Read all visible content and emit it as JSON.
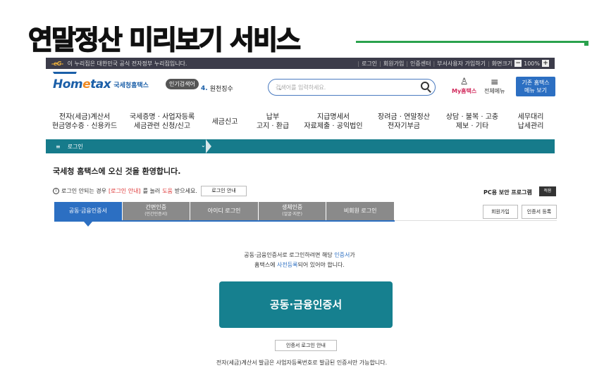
{
  "slide": {
    "title": "연말정산 미리보기 서비스"
  },
  "gov_bar": {
    "logo": "-eG-",
    "notice": "이 누리집은 대한민국 공식 전자정부 누리집입니다.",
    "links": [
      "로그인",
      "회원가입",
      "인증센터",
      "부서사용자 가입하기",
      "화면크기"
    ],
    "zoom_minus": "−",
    "zoom_value": "100%",
    "zoom_plus": "+"
  },
  "header": {
    "logo_home": "Hom",
    "logo_e": "e",
    "logo_tax": "tax",
    "logo_org": "국세청홈택스",
    "popular_label": "인기검색어",
    "popular_num": "4.",
    "popular_term": "원천징수",
    "search_placeholder": "검색어를 입력하세요.",
    "my_hometax": "My홈택스",
    "all_menu": "전체메뉴",
    "legacy_line1": "기존 홈택스",
    "legacy_line2": "메뉴 보기"
  },
  "main_nav": [
    {
      "line1": "전자(세금)계산서",
      "line2": "현금영수증 · 신용카드"
    },
    {
      "line1": "국세증명 · 사업자등록",
      "line2": "세금관련 신청/신고"
    },
    {
      "line1": "세금신고",
      "line2": ""
    },
    {
      "line1": "납부",
      "line2": "고지 · 환급"
    },
    {
      "line1": "지급명세서",
      "line2": "자료제출 · 공익법인"
    },
    {
      "line1": "장려금 · 연말정산",
      "line2": "전자기부금"
    },
    {
      "line1": "상담 · 불복 · 고충",
      "line2": "제보 · 기타"
    },
    {
      "line1": "세무대리",
      "line2": "납세관리"
    }
  ],
  "breadcrumb": {
    "menu_icon": "≡",
    "label": "로그인",
    "chevron": "⌄"
  },
  "welcome": "국세청 홈택스에 오신 것을 환영합니다.",
  "info": {
    "icon": "!",
    "before": "로그인 안되는 경우",
    "link": "[로그인 안내]",
    "middle": "를 눌러",
    "help": "도움",
    "after": "받으세요.",
    "button": "로그인 안내"
  },
  "pc_security": {
    "label": "PC용 보안 프로그램",
    "button": "적용"
  },
  "tabs": [
    {
      "label": "공동·금융인증서",
      "sub": ""
    },
    {
      "label": "간편인증",
      "sub": "(민간인증서)"
    },
    {
      "label": "아이디 로그인",
      "sub": ""
    },
    {
      "label": "생체인증",
      "sub": "(얼굴·지문)"
    },
    {
      "label": "비회원 로그인",
      "sub": ""
    }
  ],
  "side_buttons": {
    "signup": "회원가입",
    "cert_register": "인증서 등록"
  },
  "desc": {
    "l1_a": "공동·금융인증서로 로그인하려면 해당 ",
    "l1_b": "인증서",
    "l1_c": "가",
    "l2_a": "홈택스에 ",
    "l2_b": "사전등록",
    "l2_c": "되어 있어야 합니다."
  },
  "cert_button": "공동·금융인증서",
  "cert_guide_button": "인증서 로그인 안내",
  "footnote": "전자(세금)계산서 발급은 사업자등록번호로 발급된 인증서만 가능합니다.",
  "colors": {
    "teal": "#16808f",
    "blue": "#2c6fc2",
    "accent_green": "#2aa24d"
  }
}
